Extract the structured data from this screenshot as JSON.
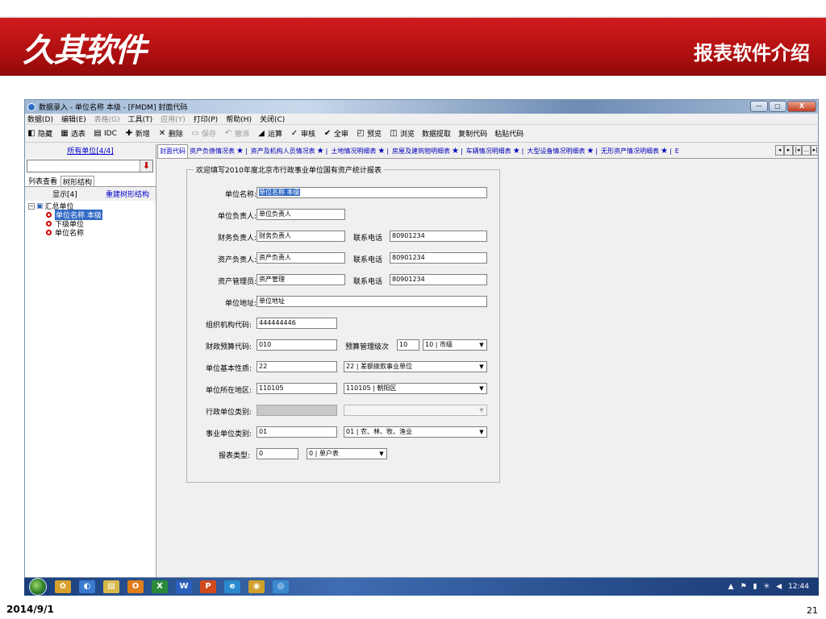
{
  "slide": {
    "logo_text": "久其软件",
    "title": "报表软件介绍",
    "date": "2014/9/1",
    "page_number": "21",
    "banner_color": "#c0141a"
  },
  "window": {
    "title": "数据录入 - 单位名称 本级 - [FMDM] 封面代码",
    "controls": {
      "minimize": "—",
      "maximize": "▢",
      "close": "X"
    }
  },
  "menubar": [
    {
      "label": "数据(D)",
      "enabled": true
    },
    {
      "label": "编辑(E)",
      "enabled": true
    },
    {
      "label": "表格(G)",
      "enabled": false
    },
    {
      "label": "工具(T)",
      "enabled": true
    },
    {
      "label": "应用(Y)",
      "enabled": false
    },
    {
      "label": "打印(P)",
      "enabled": true
    },
    {
      "label": "帮助(H)",
      "enabled": true
    },
    {
      "label": "关闭(C)",
      "enabled": true
    }
  ],
  "toolbar": [
    {
      "label": "隐藏",
      "icon": "◧",
      "icon_name": "hide-icon",
      "enabled": true
    },
    {
      "label": "选表",
      "icon": "▦",
      "icon_name": "select-table-icon",
      "enabled": true
    },
    {
      "label": "IDC",
      "icon": "▤",
      "icon_name": "idc-icon",
      "enabled": true
    },
    {
      "label": "新增",
      "icon": "✚",
      "icon_name": "add-icon",
      "enabled": true
    },
    {
      "label": "删除",
      "icon": "✕",
      "icon_name": "delete-icon",
      "enabled": true
    },
    {
      "label": "保存",
      "icon": "▭",
      "icon_name": "save-icon",
      "enabled": false
    },
    {
      "label": "撤消",
      "icon": "↶",
      "icon_name": "undo-icon",
      "enabled": false
    },
    {
      "label": "运算",
      "icon": "◢",
      "icon_name": "calculate-icon",
      "enabled": true
    },
    {
      "label": "审核",
      "icon": "✓",
      "icon_name": "audit-icon",
      "enabled": true
    },
    {
      "label": "全审",
      "icon": "✔",
      "icon_name": "audit-all-icon",
      "enabled": true
    },
    {
      "label": "预览",
      "icon": "◰",
      "icon_name": "preview-icon",
      "enabled": true
    },
    {
      "label": "浏览",
      "icon": "◫",
      "icon_name": "browse-icon",
      "enabled": true
    },
    {
      "label": "数据提取",
      "icon": "",
      "icon_name": "",
      "enabled": true
    },
    {
      "label": "复制代码",
      "icon": "",
      "icon_name": "",
      "enabled": true
    },
    {
      "label": "粘贴代码",
      "icon": "",
      "icon_name": "",
      "enabled": true
    }
  ],
  "left_pane": {
    "all_units_link": "所有单位[4/4]",
    "tabs": [
      {
        "label": "列表查看",
        "active": false
      },
      {
        "label": "树形结构",
        "active": true
      }
    ],
    "show_label": "显示[4]",
    "rebuild_link": "重建树形结构",
    "tree": {
      "root": "汇总单位",
      "children": [
        {
          "label": "单位名称 本级",
          "selected": true
        },
        {
          "label": "下级单位",
          "selected": false
        },
        {
          "label": "单位名称",
          "selected": false
        }
      ]
    }
  },
  "tabs": [
    {
      "label": "封面代码",
      "active": true
    },
    {
      "label": "资产负债情况表",
      "active": false
    },
    {
      "label": "资产及机构人员情况表",
      "active": false
    },
    {
      "label": "土地情况明细表",
      "active": false
    },
    {
      "label": "房屋及建筑物明细表",
      "active": false
    },
    {
      "label": "车辆情况明细表",
      "active": false
    },
    {
      "label": "大型设备情况明细表",
      "active": false
    },
    {
      "label": "无形资产情况明细表",
      "active": false
    },
    {
      "label": "E",
      "active": false
    }
  ],
  "tab_scroll": [
    "◂",
    "▸",
    "|◂",
    "…",
    "▸|"
  ],
  "form": {
    "legend": "欢迎填写2010年度北京市行政事业单位国有资产统计报表",
    "fields": {
      "unit_name": {
        "label": "单位名称:",
        "value": "单位名称 本级"
      },
      "unit_head": {
        "label": "单位负责人:",
        "value": "单位负责人"
      },
      "finance_head": {
        "label": "财务负责人:",
        "value": "财务负责人"
      },
      "asset_head": {
        "label": "资产负责人:",
        "value": "资产负责人"
      },
      "asset_manager": {
        "label": "资产管理员:",
        "value": "资产管理"
      },
      "phone_label": "联系电话",
      "phone_1": "80901234",
      "phone_2": "80901234",
      "phone_3": "80901234",
      "address": {
        "label": "单位地址:",
        "value": "单位地址"
      },
      "org_code": {
        "label": "组织机构代码:",
        "value": "444444446"
      },
      "budget_code": {
        "label": "财政预算代码:",
        "value": "010"
      },
      "budget_level": {
        "label": "预算管理级次",
        "value": "10",
        "select": "10 | 市级"
      },
      "unit_nature": {
        "label": "单位基本性质:",
        "value": "22",
        "select": "22 | 差额拨款事业单位"
      },
      "region": {
        "label": "单位所在地区:",
        "value": "110105",
        "select": "110105 | 朝阳区"
      },
      "admin_category": {
        "label": "行政单位类别:",
        "value": "",
        "select": ""
      },
      "institution_category": {
        "label": "事业单位类别:",
        "value": "01",
        "select": "01 | 农、林、牧、渔业"
      },
      "report_type": {
        "label": "报表类型:",
        "value": "0",
        "select": "0 | 单户表"
      }
    }
  },
  "taskbar": {
    "apps": [
      {
        "name": "aim-icon",
        "glyph": "✿",
        "color": "#d8a02c"
      },
      {
        "name": "media-icon",
        "glyph": "◐",
        "color": "#3a7ad0"
      },
      {
        "name": "explorer-icon",
        "glyph": "▤",
        "color": "#d8b84a"
      },
      {
        "name": "outlook-icon",
        "glyph": "O",
        "color": "#e07d1a"
      },
      {
        "name": "excel-icon",
        "glyph": "X",
        "color": "#2a8a3a"
      },
      {
        "name": "word-icon",
        "glyph": "W",
        "color": "#2b5fbf"
      },
      {
        "name": "powerpoint-icon",
        "glyph": "P",
        "color": "#d04a1c"
      },
      {
        "name": "ie-icon",
        "glyph": "e",
        "color": "#2a8ad0"
      },
      {
        "name": "chrome-icon",
        "glyph": "◉",
        "color": "#d0a02a"
      },
      {
        "name": "app-icon",
        "glyph": "◎",
        "color": "#3a8ad0"
      }
    ],
    "clock": "12:44"
  }
}
